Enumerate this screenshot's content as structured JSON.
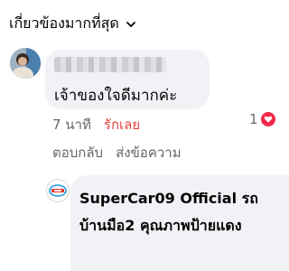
{
  "sort": {
    "label": "เกี่ยวข้องมากที่สุด",
    "icon": "chevron-down-icon"
  },
  "comment": {
    "author_redacted": true,
    "text": "เจ้าของใจดีมากค่ะ",
    "time": "7 นาที",
    "like_label": "รักเลย",
    "reaction_count": "1",
    "reaction_icon": "heart-icon",
    "reply_label": "ตอบกลับ",
    "message_label": "ส่งข้อความ"
  },
  "reply": {
    "text": "SuperCar09 Official รถบ้านมือ2 คุณภาพป้ายแดง"
  },
  "colors": {
    "like": "#e4463e",
    "heart": "#f0284a",
    "bubble": "#f0f2f5",
    "meta": "#65676b"
  }
}
